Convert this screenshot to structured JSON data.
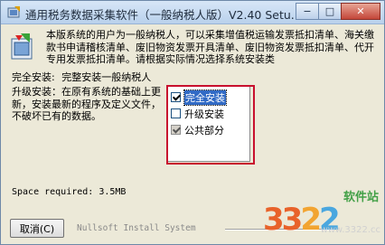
{
  "window": {
    "title": "通用税务数据采集软件（一般纳税人版）V2.40 Setu...",
    "buttons": {
      "minimize": "−",
      "maximize": "□",
      "close": "✕"
    }
  },
  "intro_text": "本版系统的用户为一般纳税人，可以采集增值税运输发票抵扣清单、海关缴款书申请稽核清单、废旧物资发票开具清单、废旧物资发票抵扣清单、代开专用发票抵扣清单。请根据实际情况选择系统安装类",
  "install_type": {
    "label": "完全安装:",
    "value": "完整安装一般纳税人"
  },
  "description": "升级安装：在原有系统的基础上更新，安装最新的程序及定义文件，不破坏已有的数据。",
  "components": [
    {
      "label": "完全安装",
      "checked": true,
      "selected": true,
      "disabled": false
    },
    {
      "label": "升级安装",
      "checked": false,
      "selected": false,
      "disabled": false
    },
    {
      "label": "公共部分",
      "checked": true,
      "selected": false,
      "disabled": true
    }
  ],
  "space_required": "Space required: 3.5MB",
  "cancel_label": "取消(C)",
  "brand_text": "Nullsoft Install System",
  "watermark": {
    "site": "软件站",
    "number_parts": [
      "3",
      "2",
      "2"
    ],
    "url": "www.3322.cc"
  },
  "colors": {
    "highlight_border": "#c8102e",
    "selection": "#316ac5"
  }
}
